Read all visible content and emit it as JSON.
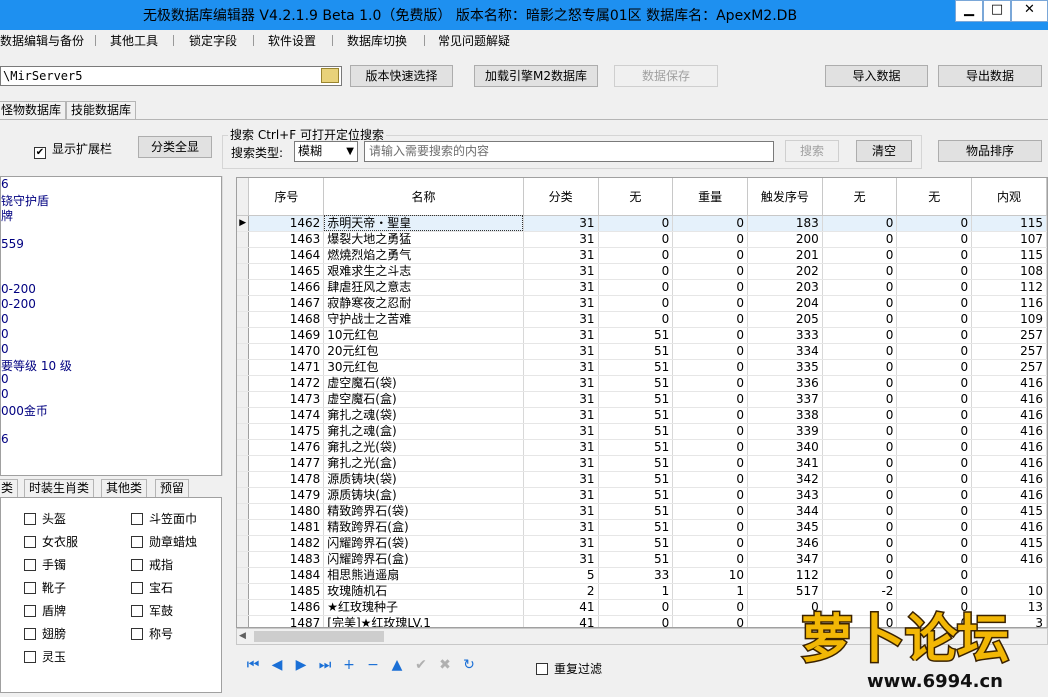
{
  "window": {
    "title": "无极数据库编辑器 V4.2.1.9    Beta 1.0（免费版）    版本名称：暗影之怒专属01区    数据库名：ApexM2.DB",
    "min": "▁",
    "max": "□",
    "close": "✕"
  },
  "menu": [
    "数据编辑与备份",
    "其他工具",
    "锁定字段",
    "软件设置",
    "数据库切换",
    "常见问题解疑"
  ],
  "toolbar": {
    "path_value": "\\MirServer5",
    "quick_select": "版本快速选择",
    "load_engine": "加载引擎M2数据库",
    "save_data": "数据保存",
    "import_data": "导入数据",
    "export_data": "导出数据"
  },
  "db_tabs": [
    "怪物数据库",
    "技能数据库"
  ],
  "options": {
    "show_ext_label": "显示扩展栏",
    "show_ext_checked": true,
    "category_all": "分类全显"
  },
  "search": {
    "title": "搜索   Ctrl+F 可打开定位搜索",
    "type_label": "搜索类型:",
    "type_value": "模糊",
    "placeholder": "请输入需要搜索的内容",
    "search_button": "搜索",
    "clear_button": "清空",
    "sort_button": "物品排序"
  },
  "left_info": [
    "6",
    "铙守护盾",
    "牌",
    "",
    "559",
    "",
    "",
    "0-200",
    "0-200",
    "0",
    "0",
    "0",
    "要等级 10 级",
    "0",
    "0",
    "000金币",
    "",
    "6"
  ],
  "bottom_tabs": [
    "类",
    "时装生肖类",
    "其他类",
    "预留"
  ],
  "checkboxes": {
    "col1": [
      "头盔",
      "女衣服",
      "手镯",
      "靴子",
      "盾牌",
      "翅膀",
      "灵玉"
    ],
    "col2": [
      "斗笠面巾",
      "勋章蜡烛",
      "戒指",
      "宝石",
      "军鼓",
      "称号"
    ]
  },
  "grid": {
    "columns": [
      "序号",
      "名称",
      "分类",
      "无",
      "重量",
      "触发序号",
      "无",
      "无",
      "内观"
    ],
    "rows": [
      [
        "1462",
        "赤明天帝・聖皇",
        "31",
        "0",
        "0",
        "183",
        "0",
        "0",
        "115"
      ],
      [
        "1463",
        "爆裂大地之勇猛",
        "31",
        "0",
        "0",
        "200",
        "0",
        "0",
        "107"
      ],
      [
        "1464",
        "燃燒烈焰之勇气",
        "31",
        "0",
        "0",
        "201",
        "0",
        "0",
        "115"
      ],
      [
        "1465",
        "艰难求生之斗志",
        "31",
        "0",
        "0",
        "202",
        "0",
        "0",
        "108"
      ],
      [
        "1466",
        "肆虐狂风之意志",
        "31",
        "0",
        "0",
        "203",
        "0",
        "0",
        "112"
      ],
      [
        "1467",
        "寂静寒夜之忍耐",
        "31",
        "0",
        "0",
        "204",
        "0",
        "0",
        "116"
      ],
      [
        "1468",
        "守护战士之苦难",
        "31",
        "0",
        "0",
        "205",
        "0",
        "0",
        "109"
      ],
      [
        "1469",
        "10元红包",
        "31",
        "51",
        "0",
        "333",
        "0",
        "0",
        "257"
      ],
      [
        "1470",
        "20元红包",
        "31",
        "51",
        "0",
        "334",
        "0",
        "0",
        "257"
      ],
      [
        "1471",
        "30元红包",
        "31",
        "51",
        "0",
        "335",
        "0",
        "0",
        "257"
      ],
      [
        "1472",
        "虚空魔石(袋)",
        "31",
        "51",
        "0",
        "336",
        "0",
        "0",
        "416"
      ],
      [
        "1473",
        "虚空魔石(盒)",
        "31",
        "51",
        "0",
        "337",
        "0",
        "0",
        "416"
      ],
      [
        "1474",
        "㚕扎之魂(袋)",
        "31",
        "51",
        "0",
        "338",
        "0",
        "0",
        "416"
      ],
      [
        "1475",
        "㚕扎之魂(盒)",
        "31",
        "51",
        "0",
        "339",
        "0",
        "0",
        "416"
      ],
      [
        "1476",
        "㚕扎之光(袋)",
        "31",
        "51",
        "0",
        "340",
        "0",
        "0",
        "416"
      ],
      [
        "1477",
        "㚕扎之光(盒)",
        "31",
        "51",
        "0",
        "341",
        "0",
        "0",
        "416"
      ],
      [
        "1478",
        "源质铸块(袋)",
        "31",
        "51",
        "0",
        "342",
        "0",
        "0",
        "416"
      ],
      [
        "1479",
        "源质铸块(盒)",
        "31",
        "51",
        "0",
        "343",
        "0",
        "0",
        "416"
      ],
      [
        "1480",
        "精致跨界石(袋)",
        "31",
        "51",
        "0",
        "344",
        "0",
        "0",
        "415"
      ],
      [
        "1481",
        "精致跨界石(盒)",
        "31",
        "51",
        "0",
        "345",
        "0",
        "0",
        "416"
      ],
      [
        "1482",
        "闪耀跨界石(袋)",
        "31",
        "51",
        "0",
        "346",
        "0",
        "0",
        "415"
      ],
      [
        "1483",
        "闪耀跨界石(盒)",
        "31",
        "51",
        "0",
        "347",
        "0",
        "0",
        "416"
      ],
      [
        "1484",
        "相思熊逍遥扇",
        "5",
        "33",
        "10",
        "112",
        "0",
        "0",
        ""
      ],
      [
        "1485",
        "玫瑰随机石",
        "2",
        "1",
        "1",
        "517",
        "-2",
        "0",
        "10"
      ],
      [
        "1486",
        "★红玫瑰种子",
        "41",
        "0",
        "0",
        "0",
        "0",
        "0",
        "13"
      ],
      [
        "1487",
        "[完美]★红玫瑰LV.1",
        "41",
        "0",
        "0",
        "0",
        "0",
        "0",
        "3"
      ]
    ]
  },
  "navbar": {
    "icons": [
      "first-icon",
      "prior-icon",
      "next-icon",
      "last-icon",
      "insert-icon",
      "delete-icon",
      "edit-icon",
      "post-icon",
      "cancel-icon",
      "refresh-icon"
    ],
    "glyphs": [
      "⏮",
      "◀",
      "▶",
      "⏭",
      "+",
      "−",
      "▲",
      "✔",
      "✖",
      "↻"
    ],
    "dup_filter": "重复过滤"
  },
  "logo": {
    "text": "萝卜论坛",
    "url": "www.6994.cn"
  }
}
